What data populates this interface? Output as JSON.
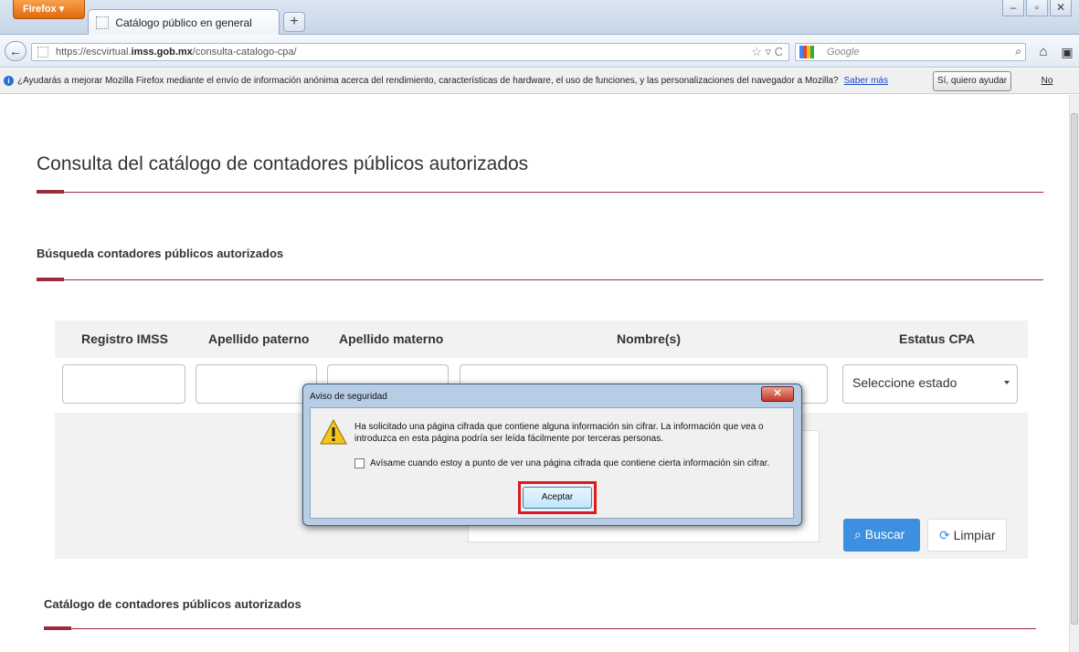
{
  "browser": {
    "menu_label": "Firefox ▾",
    "tab_title": "Catálogo público en general",
    "new_tab_label": "+",
    "window_controls": [
      "–",
      "▫",
      "✕"
    ],
    "back_label": "←",
    "url_prefix": "https://escvirtual.",
    "url_domain": "imss.gob.mx",
    "url_path": "/consulta-catalogo-cpa/",
    "url_tools": "☆ ▿ C",
    "search_placeholder": "Google",
    "search_engine_icon": "google-icon",
    "search_button": "⌕",
    "home_label": "⌂",
    "addon_label": "▣"
  },
  "notification": {
    "info_glyph": "i",
    "message": "¿Ayudarás a mejorar Mozilla Firefox mediante el envío de información anónima acerca del rendimiento, características de hardware, el uso de funciones, y las personalizaciones del navegador a Mozilla?",
    "link": "Saber más",
    "accept": "Sí, quiero ayudar",
    "decline": "No"
  },
  "page": {
    "title": "Consulta del catálogo de contadores públicos autorizados",
    "search_section": "Búsqueda contadores públicos autorizados",
    "catalog_section": "Catálogo de contadores públicos autorizados",
    "accent_color": "#9e2a3e"
  },
  "form": {
    "col_registro": "Registro IMSS",
    "col_paterno": "Apellido paterno",
    "col_materno": "Apellido materno",
    "col_nombre": "Nombre(s)",
    "col_estatus": "Estatus CPA",
    "registro_value": "",
    "paterno_value": "",
    "materno_value": "",
    "nombre_value": "",
    "estatus_selected": "Seleccione estado",
    "search_button": "Buscar",
    "search_icon": "⌕",
    "clear_button": "Limpiar",
    "clear_icon": "⟳",
    "button_color": "#3d8fe0"
  },
  "dialog": {
    "title": "Aviso de seguridad",
    "close_label": "✕",
    "message": "Ha solicitado una página cifrada que contiene alguna información sin cifrar. La información que vea o introduzca en esta página podría ser leída fácilmente por terceras personas.",
    "checkbox_label": "Avísame cuando estoy a punto de ver una página cifrada que contiene cierta información sin cifrar.",
    "checkbox_checked": false,
    "ok_button": "Aceptar",
    "highlight_color": "#e0191f",
    "warning_icon": "warning-icon"
  }
}
